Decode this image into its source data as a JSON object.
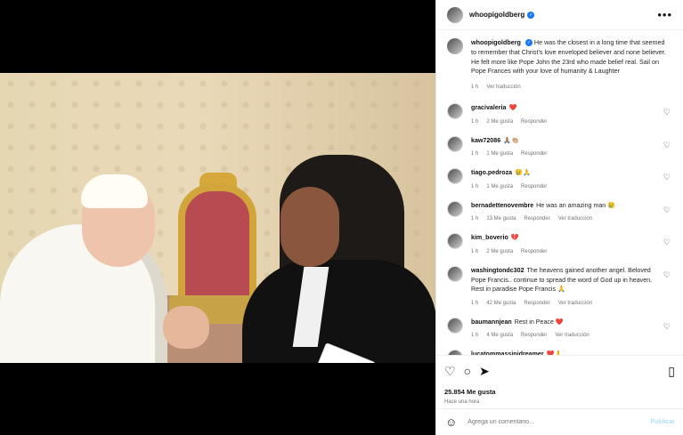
{
  "post": {
    "username": "whoopigoldberg",
    "more_icon": "more-horizontal-icon",
    "caption": "He was the closest in a long time that seemed to remember that Christ's love enveloped believer and none believer. He felt more like Pope John the 23rd who made belief real. Sail on Pope Frances with your love of humanity & Laughter",
    "caption_time": "1 h",
    "caption_translate": "Ver traducción",
    "likes": "25.854 Me gusta",
    "posted": "Hace una hora",
    "comment_placeholder": "Agrega un comentario...",
    "publish": "Publicar"
  },
  "comments": [
    {
      "user": "gracivaleria",
      "text": "❤️",
      "time": "1 h",
      "likes": "2 Me gusta",
      "reply": "Responder"
    },
    {
      "user": "kaw72086",
      "text": "🙏🏽👏🏼",
      "time": "1 h",
      "likes": "1 Me gusta",
      "reply": "Responder"
    },
    {
      "user": "tiago.pedroza",
      "text": "😢🙏",
      "time": "1 h",
      "likes": "1 Me gusta",
      "reply": "Responder"
    },
    {
      "user": "bernadettenovembre",
      "text": "He was an amazing man 😢",
      "time": "1 h",
      "likes": "13 Me gusta",
      "reply": "Responder",
      "translate": "Ver traducción"
    },
    {
      "user": "kim_boverio",
      "text": "💔",
      "time": "1 h",
      "likes": "2 Me gusta",
      "reply": "Responder"
    },
    {
      "user": "washingtondc302",
      "text": "The heavens gained another angel. Beloved Pope Francis.. continue to spread the word of God up in heaven. Rest in paradise Pope Francis 🙏",
      "time": "1 h",
      "likes": "42 Me gusta",
      "reply": "Responder",
      "translate": "Ver traducción"
    },
    {
      "user": "baumannjean",
      "text": "Rest in Peace ❤️",
      "time": "1 h",
      "likes": "4 Me gusta",
      "reply": "Responder",
      "translate": "Ver traducción"
    },
    {
      "user": "lucatommassinidreamer",
      "text": "❤️🙏"
    }
  ],
  "icons": {
    "like": "heart-icon",
    "comment": "comment-icon",
    "share": "send-icon",
    "save": "bookmark-icon",
    "emoji": "emoji-icon",
    "verified": "verified-badge-icon"
  }
}
